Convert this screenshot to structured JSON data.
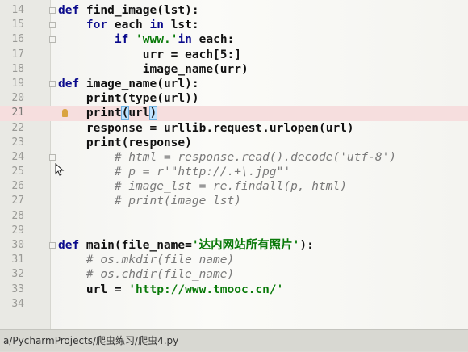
{
  "editor": {
    "lines": [
      {
        "n": "14",
        "segs": [
          [
            "kw",
            "def "
          ],
          [
            "",
            "find_image(lst):"
          ]
        ],
        "fold": true
      },
      {
        "n": "15",
        "segs": [
          [
            "",
            "    "
          ],
          [
            "kw",
            "for "
          ],
          [
            "",
            "each "
          ],
          [
            "kw",
            "in "
          ],
          [
            "",
            "lst:"
          ]
        ],
        "fold": true
      },
      {
        "n": "16",
        "segs": [
          [
            "",
            "        "
          ],
          [
            "kw",
            "if "
          ],
          [
            "str",
            "'www.'"
          ],
          [
            "kw",
            "in "
          ],
          [
            "",
            "each:"
          ]
        ],
        "fold": true
      },
      {
        "n": "17",
        "segs": [
          [
            "",
            "            urr = each[5:]"
          ]
        ]
      },
      {
        "n": "18",
        "segs": [
          [
            "",
            "            image_name(urr)"
          ]
        ]
      },
      {
        "n": "19",
        "segs": [
          [
            "kw",
            "def "
          ],
          [
            "",
            "image_name(url):"
          ]
        ],
        "fold": true
      },
      {
        "n": "20",
        "segs": [
          [
            "",
            "    print(type(url))"
          ]
        ]
      },
      {
        "n": "21",
        "segs": [
          [
            "",
            "    print"
          ],
          [
            "caret",
            "("
          ],
          [
            "",
            "url"
          ],
          [
            "caret",
            ")"
          ]
        ],
        "highlight": true,
        "marker": true
      },
      {
        "n": "22",
        "segs": [
          [
            "",
            "    response = urllib.request.urlopen(url)"
          ]
        ]
      },
      {
        "n": "23",
        "segs": [
          [
            "",
            "    print(response)"
          ]
        ]
      },
      {
        "n": "24",
        "segs": [
          [
            "",
            "        "
          ],
          [
            "cm",
            "# html = response.read().decode('utf-8')"
          ]
        ],
        "fold": true
      },
      {
        "n": "25",
        "segs": [
          [
            "",
            "        "
          ],
          [
            "cm",
            "# p = r'\"http://.+\\.jpg\"'"
          ]
        ]
      },
      {
        "n": "26",
        "segs": [
          [
            "",
            "        "
          ],
          [
            "cm",
            "# image_lst = re.findall(p, html)"
          ]
        ]
      },
      {
        "n": "27",
        "segs": [
          [
            "",
            "        "
          ],
          [
            "cm",
            "# print(image_lst)"
          ]
        ]
      },
      {
        "n": "28",
        "segs": []
      },
      {
        "n": "29",
        "segs": []
      },
      {
        "n": "30",
        "segs": [
          [
            "kw",
            "def "
          ],
          [
            "",
            "main(file_name="
          ],
          [
            "str",
            "'达内网站所有照片'"
          ],
          [
            "",
            "):"
          ]
        ],
        "fold": true
      },
      {
        "n": "31",
        "segs": [
          [
            "",
            "    "
          ],
          [
            "cm",
            "# os.mkdir(file_name)"
          ]
        ]
      },
      {
        "n": "32",
        "segs": [
          [
            "",
            "    "
          ],
          [
            "cm",
            "# os.chdir(file_name)"
          ]
        ]
      },
      {
        "n": "33",
        "segs": [
          [
            "",
            "    url = "
          ],
          [
            "str",
            "'http://www.tmooc.cn/'"
          ]
        ]
      },
      {
        "n": "34",
        "segs": []
      }
    ]
  },
  "status": {
    "path": "a/PycharmProjects/爬虫练习/爬虫4.py"
  },
  "colors": {
    "keyword": "#0a0a8c",
    "string": "#0a7a0a",
    "comment": "#7a7a7a",
    "highlight": "#f6dede"
  }
}
